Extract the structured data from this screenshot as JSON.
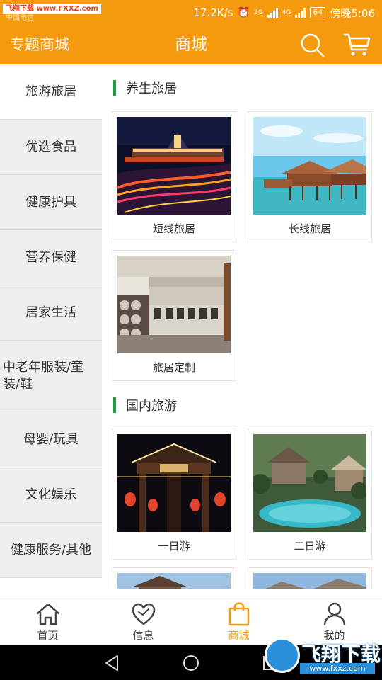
{
  "status_bar": {
    "watermark": "飞翔下载 www.FXXZ.com",
    "carrier": "中国电信",
    "speed": "17.2K/s",
    "network_2g": "2G",
    "network_4g": "4G",
    "battery": "64",
    "time": "傍晚5:06"
  },
  "header": {
    "left_label": "专题商城",
    "title": "商城",
    "search_icon": "search-icon",
    "cart_icon": "cart-icon"
  },
  "sidebar": {
    "items": [
      {
        "label": "旅游旅居",
        "active": true
      },
      {
        "label": "优选食品"
      },
      {
        "label": "健康护具"
      },
      {
        "label": "营养保健"
      },
      {
        "label": "居家生活"
      },
      {
        "label": "中老年服装/童装/鞋"
      },
      {
        "label": "母婴/玩具"
      },
      {
        "label": "文化娱乐"
      },
      {
        "label": "健康服务/其他"
      }
    ]
  },
  "sections": [
    {
      "title": "养生旅居",
      "cards": [
        {
          "label": "短线旅居",
          "image": "night-river-town"
        },
        {
          "label": "长线旅居",
          "image": "overwater-villa"
        },
        {
          "label": "旅居定制",
          "image": "hotel-building"
        }
      ]
    },
    {
      "title": "国内旅游",
      "cards": [
        {
          "label": "一日游",
          "image": "lantern-gate"
        },
        {
          "label": "二日游",
          "image": "garden-pool"
        },
        {
          "label": "",
          "image": "gate-partial"
        },
        {
          "label": "",
          "image": "hill-partial"
        }
      ]
    }
  ],
  "bottom_nav": {
    "items": [
      {
        "label": "首页",
        "icon": "home-icon"
      },
      {
        "label": "信息",
        "icon": "heart-icon"
      },
      {
        "label": "商城",
        "icon": "shopping-bag-icon",
        "active": true
      },
      {
        "label": "我的",
        "icon": "user-icon"
      }
    ]
  },
  "watermark_bottom": {
    "brand": "飞翔下载",
    "url": "www.fxxz.com"
  },
  "colors": {
    "accent": "#f59a0c",
    "section_bar": "#1f9a3e",
    "sidebar_bg": "#efefef"
  }
}
